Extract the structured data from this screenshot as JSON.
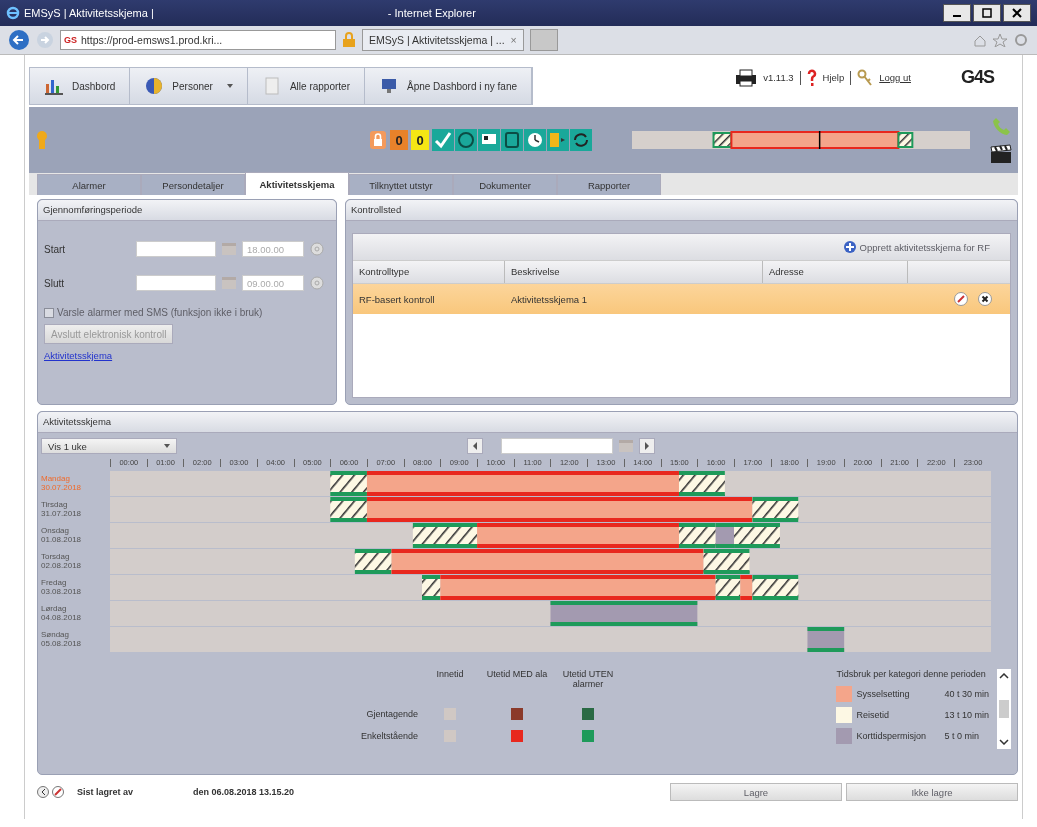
{
  "browser": {
    "title": "EMSyS | Aktivitetsskjema |",
    "app": "- Internet Explorer",
    "favicon": "GS",
    "address": "https://prod-emsws1.prod.kri...",
    "tab": "EMSyS | Aktivitetsskjema | ...",
    "tab_close": "×"
  },
  "nav": [
    {
      "label": "Dashbord",
      "dropdown": false
    },
    {
      "label": "Personer",
      "dropdown": true
    },
    {
      "label": "Alle rapporter",
      "dropdown": false
    },
    {
      "label": "Åpne Dashbord i ny fane",
      "dropdown": false
    }
  ],
  "top_right": {
    "version": "v1.11.3",
    "help": "Hjelp",
    "logout": "Logg ut",
    "logo": "G4S"
  },
  "status_counters": [
    {
      "text": "0",
      "color": "#e8822a"
    },
    {
      "text": "0",
      "color": "#f5e614"
    }
  ],
  "tabs": [
    {
      "label": "Alarmer",
      "selected": false
    },
    {
      "label": "Persondetaljer",
      "selected": false
    },
    {
      "label": "Aktivitetsskjema",
      "selected": true
    },
    {
      "label": "Tilknyttet utstyr",
      "selected": false
    },
    {
      "label": "Dokumenter",
      "selected": false
    },
    {
      "label": "Rapporter",
      "selected": false
    }
  ],
  "period": {
    "title": "Gjennomføringsperiode",
    "fields": [
      {
        "label": "Start",
        "time": "18.00.00"
      },
      {
        "label": "Slutt",
        "time": "09.00.00"
      }
    ],
    "sms": {
      "label": "Varsle alarmer med SMS (funksjon ikke i bruk)",
      "checked": false,
      "disabled": true
    },
    "end_button": {
      "label": "Avslutt elektronisk kontroll",
      "disabled": true
    },
    "link": "Aktivitetsskjema"
  },
  "control": {
    "title": "Kontrollsted",
    "create_button": {
      "label": "Opprett aktivitetsskjema for RF",
      "disabled": true
    },
    "columns": [
      "Kontrolltype",
      "Beskrivelse",
      "Adresse"
    ],
    "rows": [
      {
        "type": "RF-basert kontroll",
        "description": "Aktivitetsskjema 1",
        "selected": true
      }
    ]
  },
  "schedule": {
    "title": "Aktivitetsskjema",
    "view": "Vis 1 uke",
    "hours": [
      "00:00",
      "01:00",
      "02:00",
      "03:00",
      "04:00",
      "05:00",
      "06:00",
      "07:00",
      "08:00",
      "09:00",
      "10:00",
      "11:00",
      "12:00",
      "13:00",
      "14:00",
      "15:00",
      "16:00",
      "17:00",
      "18:00",
      "19:00",
      "20:00",
      "21:00",
      "22:00",
      "23:00"
    ],
    "days": [
      {
        "name": "Mandag",
        "date": "30.07.2018",
        "highlighted": true
      },
      {
        "name": "Tirsdag",
        "date": "31.07.2018",
        "highlighted": false
      },
      {
        "name": "Onsdag",
        "date": "01.08.2018",
        "highlighted": false
      },
      {
        "name": "Torsdag",
        "date": "02.08.2018",
        "highlighted": false
      },
      {
        "name": "Fredag",
        "date": "03.08.2018",
        "highlighted": false
      },
      {
        "name": "Lørdag",
        "date": "04.08.2018",
        "highlighted": false
      },
      {
        "name": "Søndag",
        "date": "05.08.2018",
        "highlighted": false
      }
    ],
    "legend": {
      "columns": [
        "Innetid",
        "Utetid MED ala",
        "Utetid UTEN alarmer"
      ],
      "rows": [
        {
          "label": "Gjentagende",
          "cells": [
            {
              "color": "#d0c8c4"
            },
            {
              "color": "#8b3a2a"
            },
            {
              "color": "#2a6a44"
            }
          ]
        },
        {
          "label": "Enkeltstående",
          "cells": [
            {
              "color": "#d0c8c4"
            },
            {
              "color": "#e8281e"
            },
            {
              "color": "#1e9a5a"
            }
          ]
        }
      ]
    },
    "usage": {
      "title": "Tidsbruk per kategori denne perioden",
      "items": [
        {
          "label": "Sysselsetting",
          "value": "40 t 30 min",
          "color": "#f4a58a"
        },
        {
          "label": "Reisetid",
          "value": "13 t 10 min",
          "color": "#fdf8e4"
        },
        {
          "label": "Korttidspermisjon",
          "value": "5 t 0 min",
          "color": "#a39ab0"
        }
      ]
    }
  },
  "footer": {
    "saved_by": "Sist lagret av",
    "saved_at": "den 06.08.2018 13.15.20",
    "buttons": [
      {
        "label": "Lagre",
        "disabled": true
      },
      {
        "label": "Ikke lagre",
        "disabled": true
      }
    ]
  }
}
